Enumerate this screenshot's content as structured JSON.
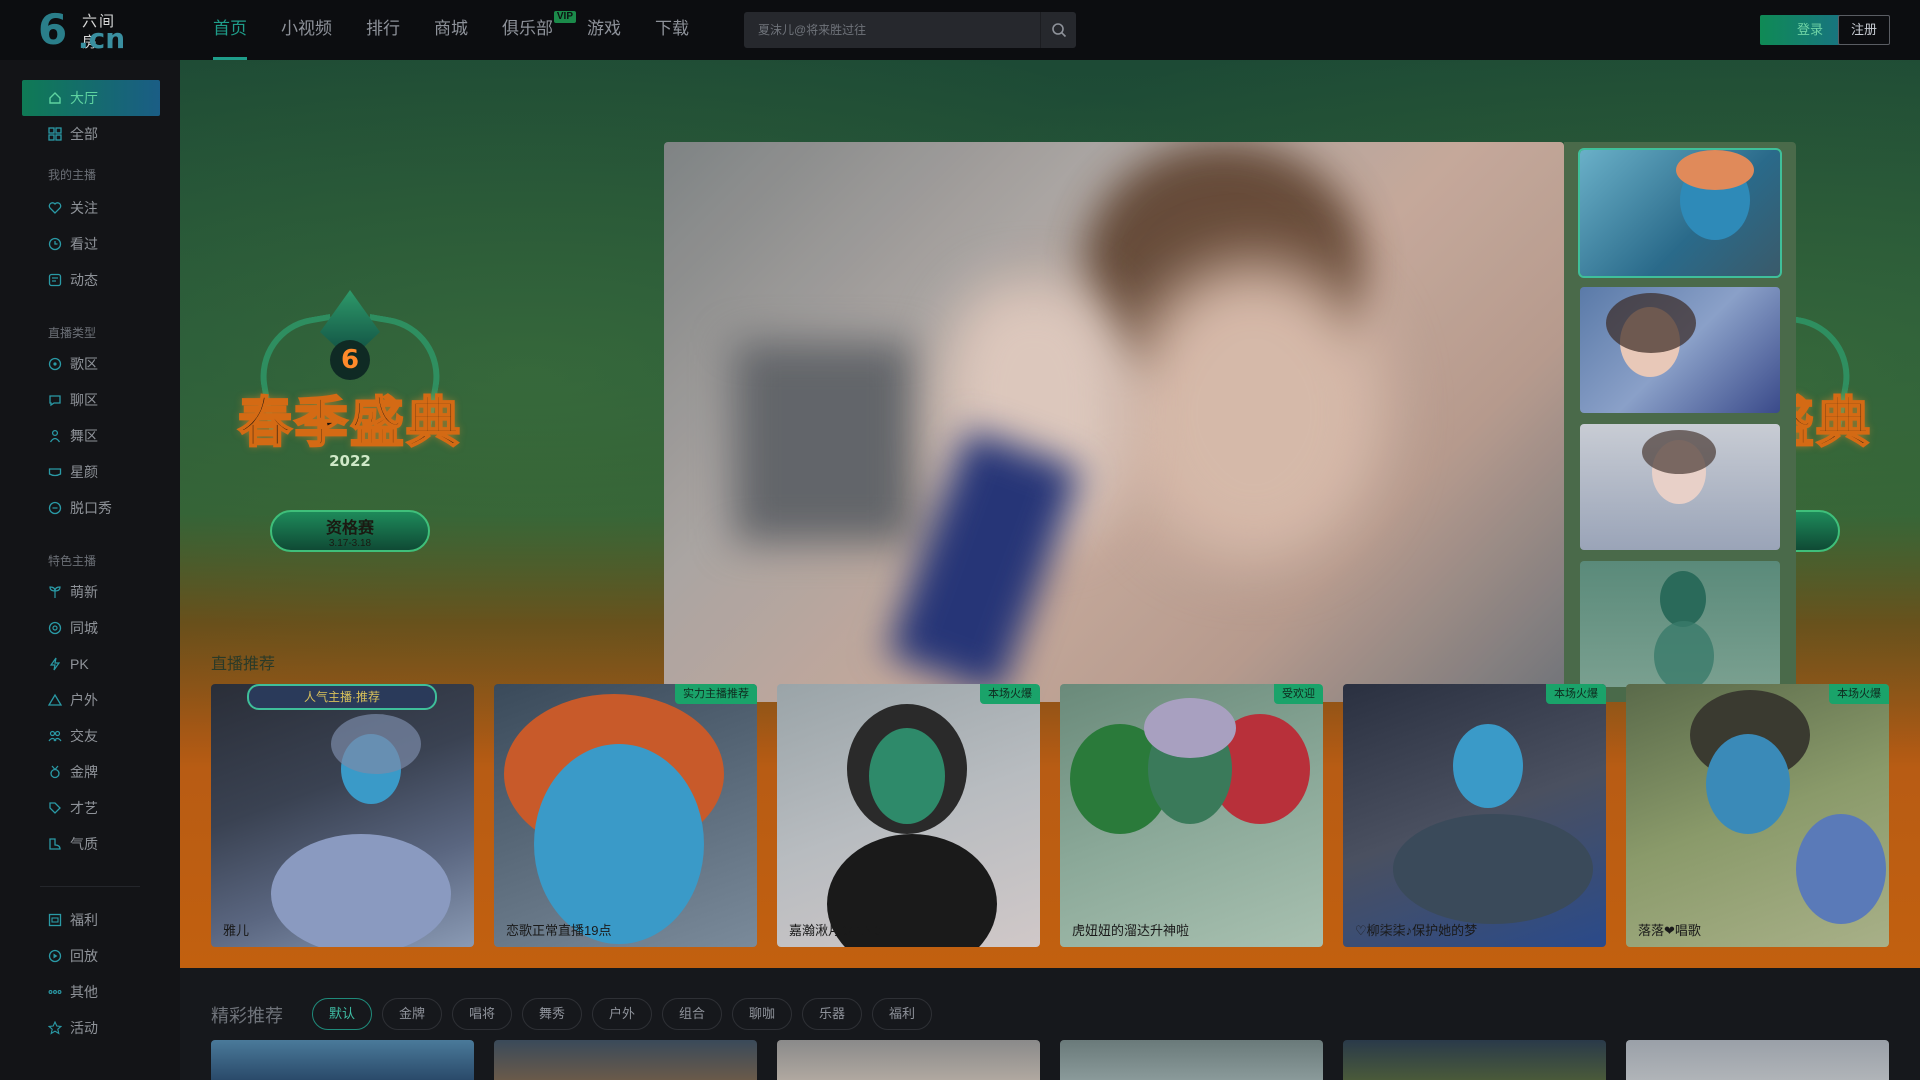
{
  "brand": {
    "logo_mark": "6",
    "logo_text": "六间房",
    "logo_domain": ".cn"
  },
  "nav": {
    "items": [
      {
        "label": "首页",
        "active": true
      },
      {
        "label": "小视频"
      },
      {
        "label": "排行"
      },
      {
        "label": "商城"
      },
      {
        "label": "俱乐部",
        "badge": "VIP"
      },
      {
        "label": "游戏"
      },
      {
        "label": "下载"
      }
    ]
  },
  "search": {
    "placeholder": "夏沫儿@将来胜过往",
    "icon": "search-icon"
  },
  "auth": {
    "login": "登录",
    "register": "注册"
  },
  "sidebar": {
    "hall": "大厅",
    "all": "全部",
    "my_anchor_head": "我的主播",
    "follow": "关注",
    "watched": "看过",
    "feed": "动态",
    "live_type_head": "直播类型",
    "song": "歌区",
    "chat": "聊区",
    "dance": "舞区",
    "star": "星颜",
    "talkshow": "脱口秀",
    "featured_head": "特色主播",
    "newbie": "萌新",
    "city": "同城",
    "pk": "PK",
    "outdoor": "户外",
    "dating": "交友",
    "gold": "金牌",
    "talent": "才艺",
    "temperament": "气质",
    "welfare": "福利",
    "replay": "回放",
    "other": "其他",
    "activity": "活动"
  },
  "banner": {
    "emblem": {
      "title": "春季盛典",
      "year": "2022",
      "pill": "资格赛",
      "dates": "3.17-3.18"
    },
    "section_label": "直播推荐"
  },
  "cards": [
    {
      "ribbon": "人气主播·推荐",
      "caption": "雅儿",
      "tag": ""
    },
    {
      "tag": "实力主播推荐",
      "caption": "恋歌正常直播19点"
    },
    {
      "tag": "本场火爆",
      "caption": "嘉瀚湫月0小时0"
    },
    {
      "tag": "受欢迎",
      "caption": "虎妞妞的溜达升神啦"
    },
    {
      "tag": "本场火爆",
      "caption": "♡柳柒柒♪保护她的梦"
    },
    {
      "tag": "本场火爆",
      "caption": "落落❤唱歌"
    }
  ],
  "recommend": {
    "title": "精彩推荐",
    "chips": [
      "默认",
      "金牌",
      "唱将",
      "舞秀",
      "户外",
      "组合",
      "聊咖",
      "乐器",
      "福利"
    ]
  },
  "colors": {
    "accent": "#1f9d8a",
    "login_gradient": "#0f8a55",
    "banner_orange": "#c2600f"
  }
}
